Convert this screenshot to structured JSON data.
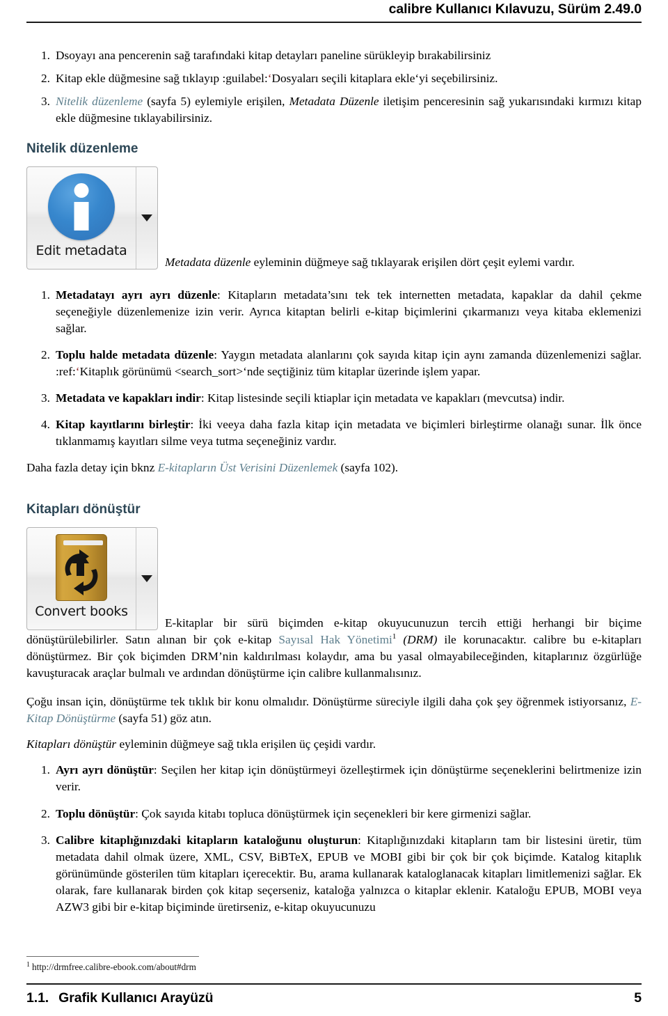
{
  "header": {
    "title": "calibre Kullanıcı Kılavuzu, Sürüm 2.49.0"
  },
  "intro_list": [
    {
      "num": "1.",
      "text": "Dsoyayı ana pencerenin sağ tarafındaki kitap detayları paneline sürükleyip bırakabilirsiniz"
    },
    {
      "num": "2.",
      "pre": "Kitap ekle düğmesine sağ tıklayıp :guilabel:",
      "quote": "‘",
      "post": "Dosyaları seçili kitaplara ekle‘yi seçebilirsiniz."
    },
    {
      "num": "3.",
      "link": "Nitelik düzenleme",
      "mid": " (sayfa 5) eylemiyle erişilen, ",
      "italic": "Metadata Düzenle",
      "post": " iletişim penceresinin sağ yukarısındaki kırmızı kitap ekle düğmesine tıklayabilirsiniz."
    }
  ],
  "section_metadata": {
    "heading": "Nitelik düzenleme",
    "button": {
      "label": "Edit metadata",
      "icon": "info-circle-icon",
      "dropdown_icon": "caret-down-icon"
    },
    "lead_italic": "Metadata düzenle",
    "lead_rest": " eyleminin düğmeye sağ tıklayarak erişilen dört çeşit eylemi vardır.",
    "items": [
      {
        "num": "1.",
        "bold": "Metadatayı ayrı ayrı düzenle",
        "text": ": Kitapların metadata’sını tek tek internetten metadata, kapaklar da dahil çekme seçeneğiyle düzenlemenize izin verir. Ayrıca kitaptan belirli e-kitap biçimlerini çıkarmanızı veya kitaba eklemenizi sağlar."
      },
      {
        "num": "2.",
        "bold": "Toplu halde metadata düzenle",
        "text": ": Yaygın metadata alanlarını çok sayıda kitap için aynı zamanda düzenlemenizi sağlar. :ref:",
        "quote": "‘",
        "text2": "Kitaplık görünümü <search_sort>‘nde seçtiğiniz tüm kitaplar üzerinde işlem yapar."
      },
      {
        "num": "3.",
        "bold": "Metadata ve kapakları indir",
        "text": ": Kitap listesinde seçili ktiaplar için metadata ve kapakları (mevcutsa) indir."
      },
      {
        "num": "4.",
        "bold": "Kitap kayıtlarını birleştir",
        "text": ": İki veeya daha fazla kitap için metadata ve biçimleri birleştirme olanağı sunar. İlk önce tıklanmamış kayıtları silme veya tutma seçeneğiniz vardır."
      }
    ],
    "more_pre": "Daha fazla detay için bknz ",
    "more_link": "E-kitapların Üst Verisini Düzenlemek",
    "more_post": " (sayfa 102)."
  },
  "section_convert": {
    "heading": "Kitapları dönüştür",
    "button": {
      "label": "Convert books",
      "icon": "convert-book-icon",
      "dropdown_icon": "caret-down-icon"
    },
    "para1_a": "E-kitaplar bir sürü biçimden e-kitap okuyucunuzun tercih ettiği herhangi bir biçime dönüştürülebilirler. Satın alınan bir çok e-kitap ",
    "para1_link": "Sayısal Hak Yönetimi",
    "para1_fn": "1",
    "para1_italic": " (DRM)",
    "para1_b": " ile korunacaktır. calibre bu e-kitapları dönüştürmez. Bir çok biçimden DRM’nin kaldırılması kolaydır, ama bu yasal olmayabileceğinden, kitaplarınız özgürlüğe kavuşturacak araçlar bulmalı ve ardından dönüştürme için calibre kullanmalısınız.",
    "para2_a": "Çoğu insan için, dönüştürme tek tıklık bir konu olmalıdır. Dönüştürme süreciyle ilgili daha çok şey öğrenmek istiyorsanız, ",
    "para2_link": "E-Kitap Dönüştürme",
    "para2_b": " (sayfa 51) göz atın.",
    "para3_italic": "Kitapları dönüştür",
    "para3_rest": " eyleminin düğmeye sağ tıkla erişilen üç çeşidi vardır.",
    "items": [
      {
        "num": "1.",
        "bold": "Ayrı ayrı dönüştür",
        "text": ": Seçilen her kitap için dönüştürmeyi özelleştirmek için dönüştürme seçeneklerini belirtmenize izin verir."
      },
      {
        "num": "2.",
        "bold": "Toplu dönüştür",
        "text": ": Çok sayıda kitabı topluca dönüştürmek için seçenekleri bir kere girmenizi sağlar."
      },
      {
        "num": "3.",
        "bold": "Calibre kitaplığınızdaki kitapların kataloğunu oluşturun",
        "text": ": Kitaplığınızdaki kitapların tam bir listesini üretir, tüm metadata dahil olmak üzere, XML, CSV, BiBTeX, EPUB ve MOBI gibi bir çok bir çok biçimde. Katalog kitaplık görünümünde gösterilen tüm kitapları içerecektir. Bu, arama kullanarak kataloglanacak kitapları limitlemenizi sağlar. Ek olarak, fare kullanarak birden çok kitap seçerseniz, kataloğa yalnızca o kitaplar eklenir. Kataloğu EPUB, MOBI veya AZW3 gibi bir e-kitap biçiminde üretirseniz, e-kitap okuyucunuzu"
      }
    ]
  },
  "footnote": {
    "marker": "1",
    "text": "http://drmfree.calibre-ebook.com/about#drm"
  },
  "footer": {
    "section_number": "1.1.",
    "section_title": "Grafik Kullanıcı Arayüzü",
    "page_number": "5"
  },
  "colors": {
    "heading": "#2d4756",
    "link": "#5e7f8d",
    "accent_red": "#8c1a1a",
    "icon_blue": "#3787cd",
    "icon_gold": "#c99a33"
  }
}
